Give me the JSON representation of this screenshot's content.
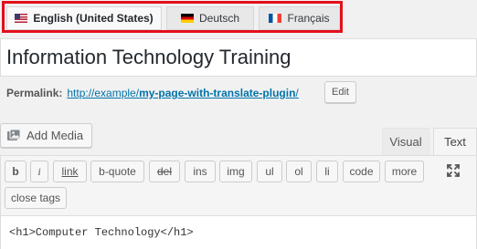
{
  "languages": [
    {
      "label": "English (United States)",
      "flag": "us-flag-icon",
      "active": true
    },
    {
      "label": "Deutsch",
      "flag": "de-flag-icon",
      "active": false
    },
    {
      "label": "Français",
      "flag": "fr-flag-icon",
      "active": false
    }
  ],
  "title": "Information Technology Training",
  "permalink": {
    "label": "Permalink:",
    "base": "http://example/",
    "slug": "my-page-with-translate-plugin",
    "suffix": "/",
    "edit_label": "Edit"
  },
  "add_media_label": "Add Media",
  "editor_tabs": {
    "visual": "Visual",
    "text": "Text"
  },
  "quicktags": [
    "b",
    "i",
    "link",
    "b-quote",
    "del",
    "ins",
    "img",
    "ul",
    "ol",
    "li",
    "code",
    "more",
    "close tags"
  ],
  "content": "<h1>Computer Technology</h1>",
  "colors": {
    "highlight_border": "#e2101b",
    "link": "#0073aa"
  }
}
